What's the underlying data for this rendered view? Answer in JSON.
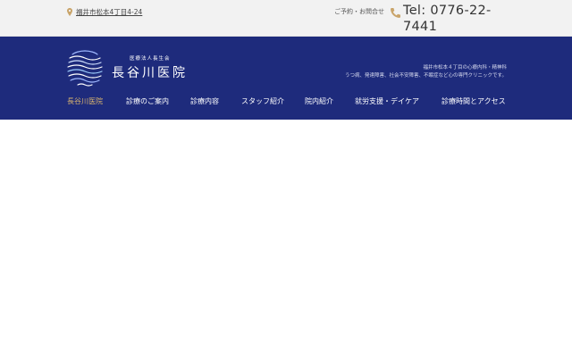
{
  "topbar": {
    "address": "福井市松本4丁目4-24",
    "contact_label": "ご予約・お問合せ",
    "tel": "Tel: 0776-22-7441"
  },
  "header": {
    "logo_sub": "医療法人長生会",
    "logo_name": "長谷川医院",
    "tagline_1": "福井市松本４丁目の心療内科・精神科",
    "tagline_2": "うつ病、発達障害、社会不安障害、不眠症など心の専門クリニックです。"
  },
  "nav": {
    "items": [
      {
        "label": "長谷川医院"
      },
      {
        "label": "診療のご案内"
      },
      {
        "label": "診療内容"
      },
      {
        "label": "スタッフ紹介"
      },
      {
        "label": "院内紹介"
      },
      {
        "label": "就労支援・デイケア"
      },
      {
        "label": "診療時間とアクセス"
      }
    ]
  },
  "colors": {
    "header_bg": "#1e2b7c",
    "topbar_bg": "#f2f2f2",
    "accent": "#d9b46e",
    "icon": "#c9a46a"
  },
  "icons": {
    "address": "map-pin-icon",
    "phone": "phone-icon",
    "logo": "wave-logo-icon"
  }
}
